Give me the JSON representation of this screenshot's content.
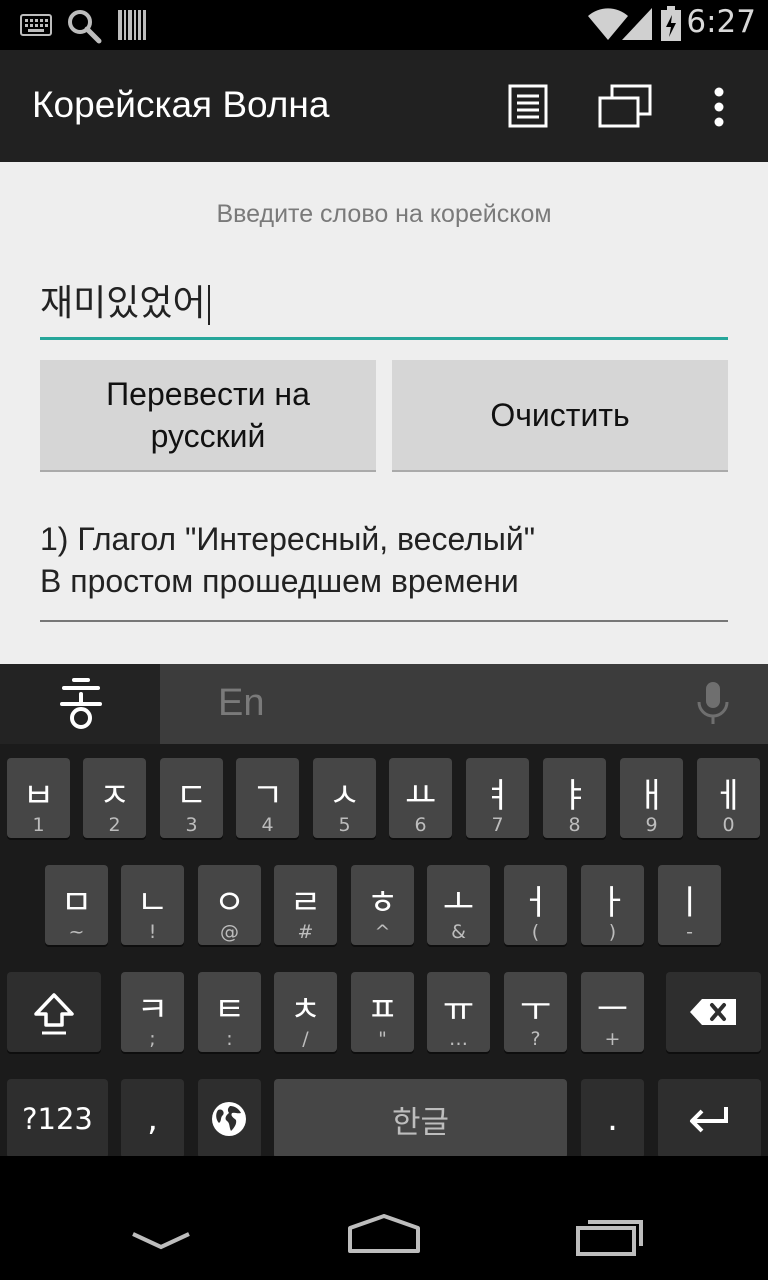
{
  "status_bar": {
    "time": "6:27"
  },
  "app_bar": {
    "title": "Корейская Волна"
  },
  "form": {
    "hint": "Введите слово на корейском",
    "input_value": "재미있었어",
    "translate_button": "Перевести на русский",
    "clear_button": "Очистить"
  },
  "result": {
    "line1": "1) Глагол \"Интересный, веселый\"",
    "line2": "В простом прошедшем времени"
  },
  "keyboard": {
    "lang_label": "En",
    "row1": [
      {
        "main": "ㅂ",
        "sub": "1"
      },
      {
        "main": "ㅈ",
        "sub": "2"
      },
      {
        "main": "ㄷ",
        "sub": "3"
      },
      {
        "main": "ㄱ",
        "sub": "4"
      },
      {
        "main": "ㅅ",
        "sub": "5"
      },
      {
        "main": "ㅛ",
        "sub": "6"
      },
      {
        "main": "ㅕ",
        "sub": "7"
      },
      {
        "main": "ㅑ",
        "sub": "8"
      },
      {
        "main": "ㅐ",
        "sub": "9"
      },
      {
        "main": "ㅔ",
        "sub": "0"
      }
    ],
    "row2": [
      {
        "main": "ㅁ",
        "sub": "~"
      },
      {
        "main": "ㄴ",
        "sub": "!"
      },
      {
        "main": "ㅇ",
        "sub": "@"
      },
      {
        "main": "ㄹ",
        "sub": "#"
      },
      {
        "main": "ㅎ",
        "sub": "^"
      },
      {
        "main": "ㅗ",
        "sub": "&"
      },
      {
        "main": "ㅓ",
        "sub": "("
      },
      {
        "main": "ㅏ",
        "sub": ")"
      },
      {
        "main": "ㅣ",
        "sub": "-"
      }
    ],
    "row3": [
      {
        "main": "ㅋ",
        "sub": ";"
      },
      {
        "main": "ㅌ",
        "sub": ":"
      },
      {
        "main": "ㅊ",
        "sub": "/"
      },
      {
        "main": "ㅍ",
        "sub": "\""
      },
      {
        "main": "ㅠ",
        "sub": "…"
      },
      {
        "main": "ㅜ",
        "sub": "?"
      },
      {
        "main": "ㅡ",
        "sub": "+"
      }
    ],
    "symbols_label": "?123",
    "comma_label": ",",
    "space_label": "한글",
    "period_label": "."
  },
  "icons": {
    "status_left": [
      "keyboard-icon",
      "search-icon",
      "barcode-icon"
    ],
    "status_right": [
      "wifi-icon",
      "signal-icon",
      "battery-icon"
    ],
    "app_bar": [
      "list-icon",
      "windows-icon",
      "overflow-menu-icon"
    ],
    "keyboard_top": [
      "hangul-mode-icon",
      "microphone-icon"
    ],
    "keyboard_keys": [
      "shift-icon",
      "backspace-icon",
      "globe-icon",
      "enter-icon"
    ],
    "nav": [
      "back-icon",
      "home-icon",
      "recents-icon"
    ]
  },
  "colors": {
    "accent": "#26a69a",
    "app_bar": "#212121",
    "content_bg": "#eeeeee",
    "keyboard_bg": "#1b1b1b"
  }
}
